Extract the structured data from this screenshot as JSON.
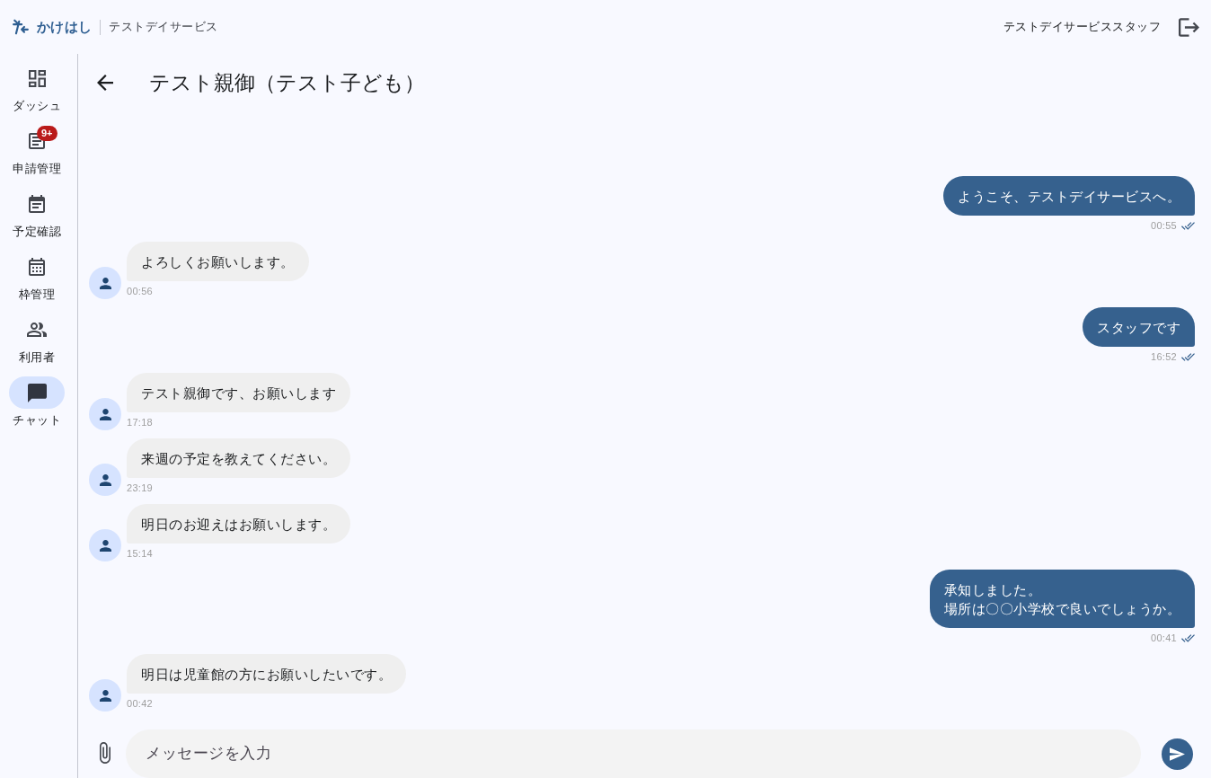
{
  "header": {
    "app_name": "かけはし",
    "service_name": "テストデイサービス",
    "user_name": "テストデイサービススタッフ"
  },
  "nav": [
    {
      "kind": "dashboard",
      "label": "ダッシュ",
      "selected": false
    },
    {
      "kind": "requests",
      "label": "申請管理",
      "badge": "9+",
      "selected": false
    },
    {
      "kind": "schedule",
      "label": "予定確認",
      "selected": false
    },
    {
      "kind": "slots",
      "label": "枠管理",
      "selected": false
    },
    {
      "kind": "users",
      "label": "利用者",
      "selected": false
    },
    {
      "kind": "chat",
      "label": "チャット",
      "selected": true
    }
  ],
  "chat": {
    "title": "テスト親御（テスト子ども）",
    "messages": [
      {
        "kind": "sent",
        "lines": [
          "ようこそ、テストデイサービスへ。"
        ],
        "time": "00:55",
        "read": true
      },
      {
        "kind": "received",
        "lines": [
          "よろしくお願いします。"
        ],
        "time": "00:56"
      },
      {
        "kind": "sent",
        "lines": [
          "スタッフです"
        ],
        "time": "16:52",
        "read": true
      },
      {
        "kind": "received",
        "lines": [
          "テスト親御です、お願いします"
        ],
        "time": "17:18"
      },
      {
        "kind": "received",
        "lines": [
          "来週の予定を教えてください。"
        ],
        "time": "23:19"
      },
      {
        "kind": "received",
        "lines": [
          "明日のお迎えはお願いします。"
        ],
        "time": "15:14"
      },
      {
        "kind": "sent",
        "lines": [
          "承知しました。",
          "場所は〇〇小学校で良いでしょうか。"
        ],
        "time": "00:41",
        "read": true
      },
      {
        "kind": "received",
        "lines": [
          "明日は児童館の方にお願いしたいです。"
        ],
        "time": "00:42"
      }
    ],
    "input": {
      "placeholder": "メッセージを入力"
    }
  }
}
